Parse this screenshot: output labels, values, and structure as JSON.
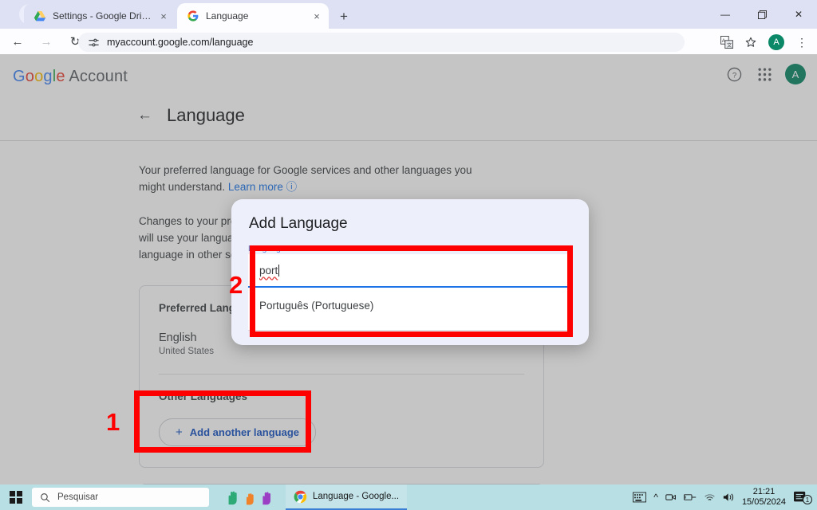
{
  "browser": {
    "tabs": [
      {
        "title": "Settings - Google Drive",
        "icon": "drive-icon",
        "active": false
      },
      {
        "title": "Language",
        "icon": "google-g-icon",
        "active": true
      }
    ],
    "new_tab_label": "+",
    "tab_close_label": "×",
    "tab_list_chevron": "˅",
    "window_controls": {
      "minimize": "—",
      "maximize": "❐",
      "close": "✕"
    },
    "nav": {
      "back": "←",
      "forward": "→",
      "reload": "↻"
    },
    "omnibox": {
      "url": "myaccount.google.com/language",
      "site_icon": "tune-icon"
    },
    "toolbar_right": {
      "translate_icon": "translate-icon",
      "bookmark_icon": "star-icon",
      "profile_initial": "A",
      "menu_icon": "kebab-menu-icon"
    }
  },
  "google_header": {
    "logo_letters": [
      "G",
      "o",
      "o",
      "g",
      "l",
      "e"
    ],
    "logo_word2": "Account",
    "help_icon": "help-circle-icon",
    "apps_icon": "apps-grid-icon",
    "avatar_initial": "A"
  },
  "page": {
    "back_arrow": "←",
    "title": "Language",
    "paragraph1_part1": "Your preferred language for Google services and other languages you might understand.",
    "learn_more": "Learn more",
    "learn_more_icon": "help-circle-icon",
    "paragraph2": "Changes to your preferred language may take a moment. Google services will use your language in the products and services. To change the language in other services, see the language settings on your device.",
    "card": {
      "preferred_heading": "Preferred Language",
      "language_name": "English",
      "language_region": "United States",
      "other_heading": "Other Languages",
      "add_button_label": "Add another language",
      "add_button_plus": "+"
    }
  },
  "modal": {
    "title": "Add Language",
    "field_label": "Language",
    "input_value": "port",
    "suggestions": [
      "Português (Portuguese)"
    ]
  },
  "annotations": [
    {
      "number": "1",
      "target": "add-another-language-button"
    },
    {
      "number": "2",
      "target": "language-search-field"
    }
  ],
  "taskbar": {
    "start_label": "windows-start-icon",
    "search_placeholder": "Pesquisar",
    "search_icon": "magnifier-icon",
    "widget_icon": "hands-widget-icon",
    "running_app": "Language - Google...",
    "running_app_icon": "chrome-icon",
    "tray": {
      "keyboard_icon": "keyboard-icon",
      "chevron_icon": "chevron-up-icon",
      "meet_icon": "camera-icon",
      "device_icon": "usb-icon",
      "wifi_icon": "wifi-icon",
      "volume_icon": "speaker-icon",
      "time": "21:21",
      "date": "15/05/2024",
      "notification_icon": "notification-icon",
      "notification_count": "1"
    }
  },
  "colors": {
    "accent_blue": "#1a73e8",
    "annotation_red": "#fe0000",
    "avatar_green": "#0b8868",
    "taskbar": "#b8dfe4",
    "modal_bg": "#edf0fa"
  }
}
